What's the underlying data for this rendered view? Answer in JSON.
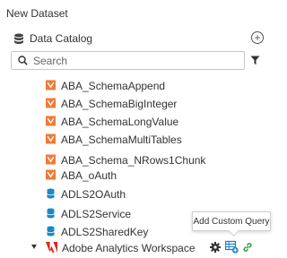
{
  "title": "New Dataset",
  "catalog": {
    "label": "Data Catalog",
    "icon": "database-icon",
    "add_icon": "plus-circle-icon"
  },
  "search": {
    "placeholder": "Search",
    "icon": "search-icon",
    "filter_icon": "filter-icon"
  },
  "items": [
    {
      "label": "ABA_SchemaAppend",
      "icon": "orange-check-icon"
    },
    {
      "label": "ABA_SchemaBigInteger",
      "icon": "orange-check-icon"
    },
    {
      "label": "ABA_SchemaLongValue",
      "icon": "orange-check-icon"
    },
    {
      "label": "ABA_SchemaMultiTables",
      "icon": "orange-check-icon"
    },
    {
      "label": "ABA_Schema_NRows1Chunk",
      "icon": "orange-check-icon"
    },
    {
      "label": "ABA_oAuth",
      "icon": "orange-check-icon"
    },
    {
      "label": "ADLS2OAuth",
      "icon": "blue-cylinder-icon"
    },
    {
      "label": "ADLS2Service",
      "icon": "blue-cylinder-icon"
    },
    {
      "label": "ADLS2SharedKey",
      "icon": "blue-cylinder-icon"
    }
  ],
  "expanded_item": {
    "label": "Adobe Analytics Workspace",
    "icon": "adobe-icon",
    "actions": [
      "gear-icon",
      "add-query-icon",
      "link-icon"
    ]
  },
  "tooltip": "Add Custom Query",
  "colors": {
    "orange": "#f07a38",
    "blue": "#1a86c8",
    "adobe_red": "#e1251b",
    "link_green": "#3aa54a"
  }
}
